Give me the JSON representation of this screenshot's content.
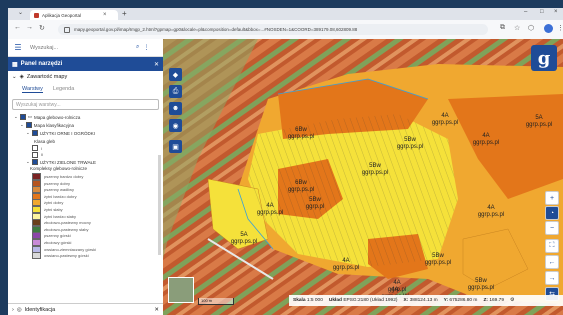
{
  "browser": {
    "tab_title": "Aplikacja Geoportal",
    "url": "mapy.geoportal.gov.pl/imap/Imgp_2.html?gpmap=gp0&locale=pl&composition=default&bbox=...#NOSDEN=1&COORD=389179.08,602809.88"
  },
  "search": {
    "placeholder": "Wyszukaj..."
  },
  "panel": {
    "title": "Panel narzędzi",
    "section": "Zawartość mapy",
    "tab_layers": "Warstwy",
    "tab_legend": "Legenda",
    "filter_placeholder": "Wyszukaj warstwy...",
    "tree": [
      "Mapa glebowo-rolnicza",
      "Mapa klasyfikacyjna",
      "UŻYTKI ORNE I OGRÓDKI",
      "Klasa gleb"
    ],
    "class_legend": [
      "I",
      "II"
    ],
    "tree2": "UŻYTKI ZIELONE TRWAŁE",
    "legend_header": "Kompleksy glebowo-rolnicze",
    "legend": [
      {
        "label": "pszenny bardzo dobry",
        "color": "#7a2323"
      },
      {
        "label": "pszenny dobry",
        "color": "#b5541e"
      },
      {
        "label": "pszenny wadliwy",
        "color": "#d98a3b"
      },
      {
        "label": "żytni bardzo dobry",
        "color": "#e3761a"
      },
      {
        "label": "żytni dobry",
        "color": "#f0a830"
      },
      {
        "label": "żytni słaby",
        "color": "#f5e13a"
      },
      {
        "label": "żytni bardzo słaby",
        "color": "#fbf4a0"
      },
      {
        "label": "zbożowo-pastewny mocny",
        "color": "#6b3f1a"
      },
      {
        "label": "zbożowo-pastewny słaby",
        "color": "#3e7b3f"
      },
      {
        "label": "pszenny górski",
        "color": "#8b46a8"
      },
      {
        "label": "zbożowy górski",
        "color": "#c98ad7"
      },
      {
        "label": "owsiano-ziemniaczany górski",
        "color": "#b9b9e8"
      },
      {
        "label": "owsiano-pastewny górski",
        "color": "#d9d9d9"
      }
    ],
    "footer": "Identyfikacja"
  },
  "statusbar": {
    "scale_label": "Skala",
    "scale": "1:5 000",
    "crs_label": "Układ",
    "crs": "EPSG:2180 (Układ 1992)",
    "x_label": "X:",
    "x": "388124.13 m",
    "y_label": "Y:",
    "y": "675286.80 m",
    "z_label": "Z:",
    "z": "169.79"
  },
  "scalebar": "100 m",
  "map": {
    "labels": [
      "4A\nggrp.ps.pl",
      "6Bw\nggrp.ps.pl",
      "5Bw\nggrp.ps.pl",
      "4A\nggrp.ps.pl",
      "5Bw\nggrp.ps.pl",
      "6Bw\nggrp.ps.pl",
      "4A\nggrp.ps.pl",
      "5A\nggrp.ps.pl",
      "5Bw\nggrp.pl",
      "5Bw\nggrp.ps.pl",
      "4A\nggrp.ps.pl",
      "4A\nggrp.pl",
      "5Bw\nggrp.ps.pl",
      "4A\nggrp.ps.W",
      "4A\nggrp.ps.pl",
      "5A\nggrp.ps.pl"
    ]
  }
}
